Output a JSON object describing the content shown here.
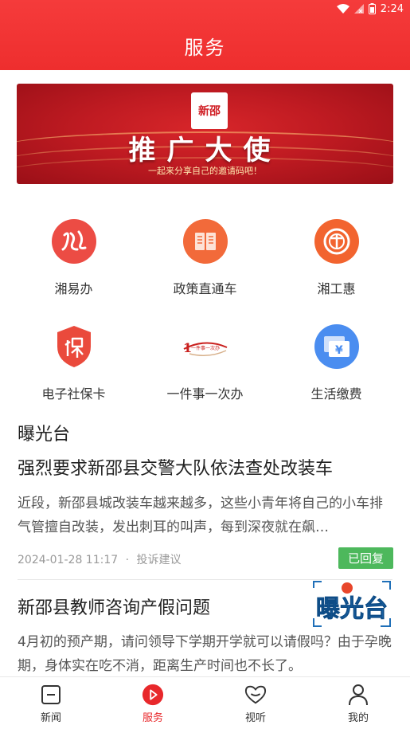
{
  "status_bar": {
    "time": "2:24"
  },
  "header": {
    "title": "服务"
  },
  "banner": {
    "logo_text": "新邵",
    "headline": "推广大使",
    "subline": "一起来分享自己的邀请码吧！"
  },
  "services": [
    {
      "label": "湘易办",
      "icon": "xiangyiban-icon"
    },
    {
      "label": "政策直通车",
      "icon": "policy-book-icon"
    },
    {
      "label": "湘工惠",
      "icon": "union-emblem-icon"
    },
    {
      "label": "电子社保卡",
      "icon": "social-security-shield-icon"
    },
    {
      "label": "一件事一次办",
      "icon": "one-thing-once-icon",
      "icon_text": "一件事一次办"
    },
    {
      "label": "生活缴费",
      "icon": "payment-card-icon",
      "icon_text": "¥"
    }
  ],
  "exposure": {
    "section_title": "曝光台",
    "posts": [
      {
        "title": "强烈要求新邵县交警大队依法查处改装车",
        "body": "近段，新邵县城改装车越来越多，这些小青年将自己的小车排气管擅自改装，发出刺耳的叫声，每到深夜就在飙…",
        "date": "2024-01-28 11:17",
        "separator": "·",
        "category": "投诉建议",
        "status": "已回复"
      },
      {
        "title": "新邵县教师咨询产假问题",
        "body": "4月初的预产期，请问领导下学期开学就可以请假吗？由于孕晚期，身体实在吃不消，距离生产时间也不长了。"
      }
    ]
  },
  "watermark": {
    "text": "曝光台"
  },
  "tabbar": {
    "tabs": [
      {
        "label": "新闻",
        "icon": "news-icon"
      },
      {
        "label": "服务",
        "icon": "service-icon",
        "active": true
      },
      {
        "label": "视听",
        "icon": "heart-video-icon"
      },
      {
        "label": "我的",
        "icon": "profile-icon"
      }
    ]
  },
  "colors": {
    "brand_red": "#ee2e2e",
    "badge_green": "#4db85c"
  }
}
